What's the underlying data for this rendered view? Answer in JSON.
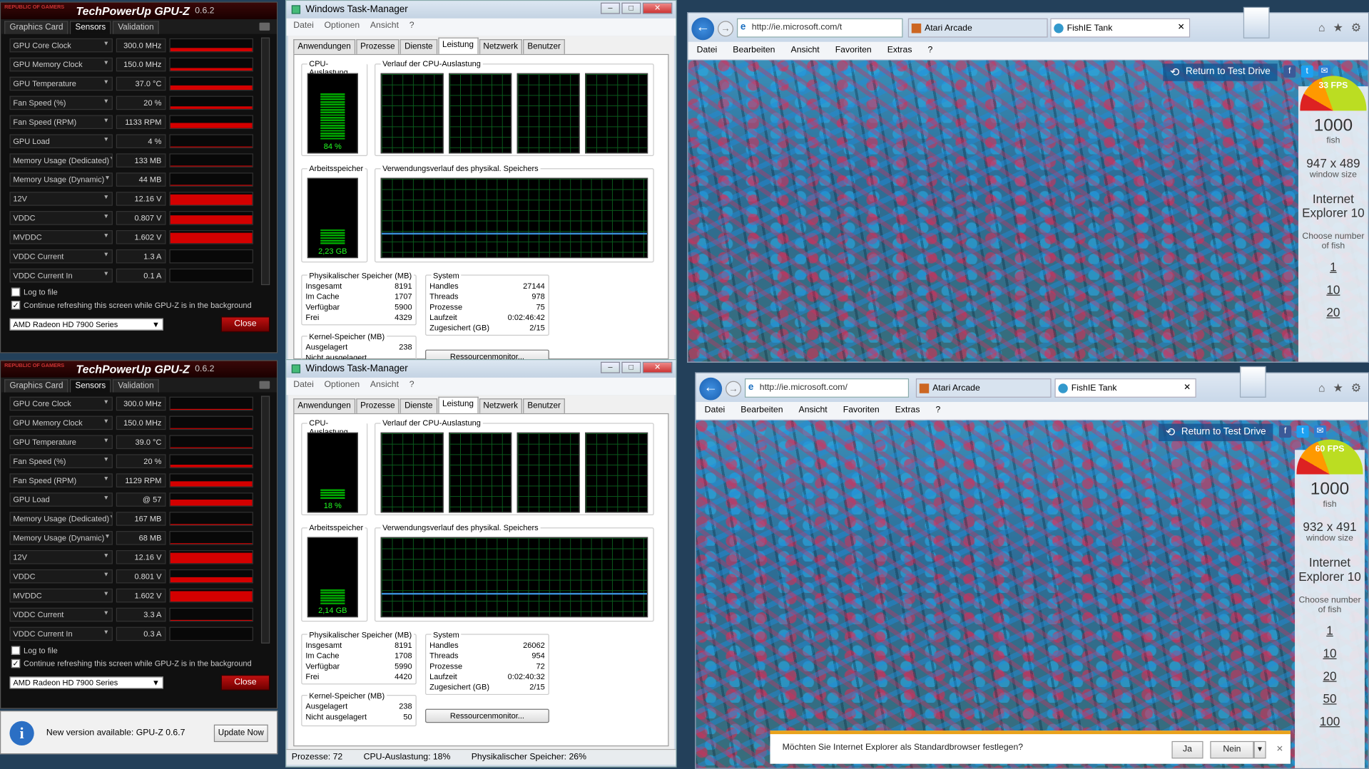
{
  "gpuz": {
    "title": "TechPowerUp GPU-Z",
    "version": "0.6.2",
    "logo": "REPUBLIC OF GAMERS",
    "tabs": [
      "Graphics Card",
      "Sensors",
      "Validation"
    ],
    "log_label": "Log to file",
    "refresh_label": "Continue refreshing this screen while GPU-Z is in the background",
    "gpu_name": "AMD Radeon HD 7900 Series",
    "close": "Close",
    "labels": [
      "GPU Core Clock",
      "GPU Memory Clock",
      "GPU Temperature",
      "Fan Speed (%)",
      "Fan Speed (RPM)",
      "GPU Load",
      "Memory Usage (Dedicated)",
      "Memory Usage (Dynamic)",
      "12V",
      "VDDC",
      "MVDDC",
      "VDDC Current",
      "VDDC Current In"
    ],
    "top": {
      "values": [
        "300.0 MHz",
        "150.0 MHz",
        "37.0 °C",
        "20 %",
        "1133 RPM",
        "4 %",
        "133 MB",
        "44 MB",
        "12.16 V",
        "0.807 V",
        "1.602 V",
        "1.3 A",
        "0.1 A"
      ],
      "fills": [
        0.3,
        0.2,
        0.35,
        0.2,
        0.45,
        0.05,
        0.05,
        0.05,
        0.85,
        0.7,
        0.85,
        0.02,
        0.02
      ]
    },
    "bottom": {
      "values": [
        "300.0 MHz",
        "150.0 MHz",
        "39.0 °C",
        "20 %",
        "1129 RPM",
        "@ 57",
        "167 MB",
        "68 MB",
        "12.16 V",
        "0.801 V",
        "1.602 V",
        "3.3 A",
        "0.3 A"
      ],
      "fills": [
        0.1,
        0.1,
        0.1,
        0.2,
        0.45,
        0.5,
        0.05,
        0.05,
        0.85,
        0.4,
        0.85,
        0.1,
        0.02
      ]
    }
  },
  "update": {
    "text": "New version available: GPU-Z 0.6.7",
    "button": "Update Now"
  },
  "taskmgr": {
    "title": "Windows Task-Manager",
    "menu": [
      "Datei",
      "Optionen",
      "Ansicht",
      "?"
    ],
    "tabs": [
      "Anwendungen",
      "Prozesse",
      "Dienste",
      "Leistung",
      "Netzwerk",
      "Benutzer"
    ],
    "cpu_label": "CPU-Auslastung",
    "cpu_hist_label": "Verlauf der CPU-Auslastung",
    "mem_label": "Arbeitsspeicher",
    "mem_hist_label": "Verwendungsverlauf des physikal. Speichers",
    "phys_title": "Physikalischer Speicher (MB)",
    "phys_keys": [
      "Insgesamt",
      "Im Cache",
      "Verfügbar",
      "Frei"
    ],
    "sys_title": "System",
    "sys_keys": [
      "Handles",
      "Threads",
      "Prozesse",
      "Laufzeit",
      "Zugesichert (GB)"
    ],
    "kernel_title": "Kernel-Speicher (MB)",
    "kernel_keys": [
      "Ausgelagert",
      "Nicht ausgelagert"
    ],
    "resmon": "Ressourcenmonitor...",
    "top": {
      "cpu": "84 %",
      "cpu_frac": 0.84,
      "mem": "2,23 GB",
      "mem_frac": 0.28,
      "phys": [
        "8191",
        "1707",
        "5900",
        "4329"
      ],
      "sys": [
        "27144",
        "978",
        "75",
        "0:02:46:42",
        "2/15"
      ],
      "kernel": [
        "238",
        ""
      ]
    },
    "bottom": {
      "cpu": "18 %",
      "cpu_frac": 0.18,
      "mem": "2,14 GB",
      "mem_frac": 0.27,
      "phys": [
        "8191",
        "1708",
        "5990",
        "4420"
      ],
      "sys": [
        "26062",
        "954",
        "72",
        "0:02:40:32",
        "2/15"
      ],
      "kernel": [
        "238",
        "50"
      ]
    },
    "status": [
      "Prozesse: 72",
      "CPU-Auslastung: 18%",
      "Physikalischer Speicher: 26%"
    ]
  },
  "ie": {
    "url": "http://ie.microsoft.com/t",
    "url2": "http://ie.microsoft.com/",
    "tab1": "Atari Arcade",
    "tab2": "FishIE Tank",
    "menu": [
      "Datei",
      "Bearbeiten",
      "Ansicht",
      "Favoriten",
      "Extras",
      "?"
    ],
    "return": "Return to Test Drive",
    "top": {
      "fps": "33 FPS",
      "fish": "1000",
      "fish_lbl": "fish",
      "size": "947 x 489",
      "size_lbl": "window size",
      "browser": "Internet Explorer 10",
      "choose": "Choose number of fish",
      "links": [
        "1",
        "10",
        "20"
      ]
    },
    "bottom": {
      "fps": "60 FPS",
      "fish": "1000",
      "fish_lbl": "fish",
      "size": "932 x 491",
      "size_lbl": "window size",
      "browser": "Internet Explorer 10",
      "choose": "Choose number of fish",
      "links": [
        "1",
        "10",
        "20",
        "50",
        "100"
      ]
    },
    "notify": {
      "text": "Möchten Sie Internet Explorer als Standardbrowser festlegen?",
      "yes": "Ja",
      "no": "Nein"
    }
  },
  "colors": {
    "gpuz_red": "#d40000",
    "cpu_green": "#00aa00",
    "ie_blue": "#1a5fb0"
  }
}
